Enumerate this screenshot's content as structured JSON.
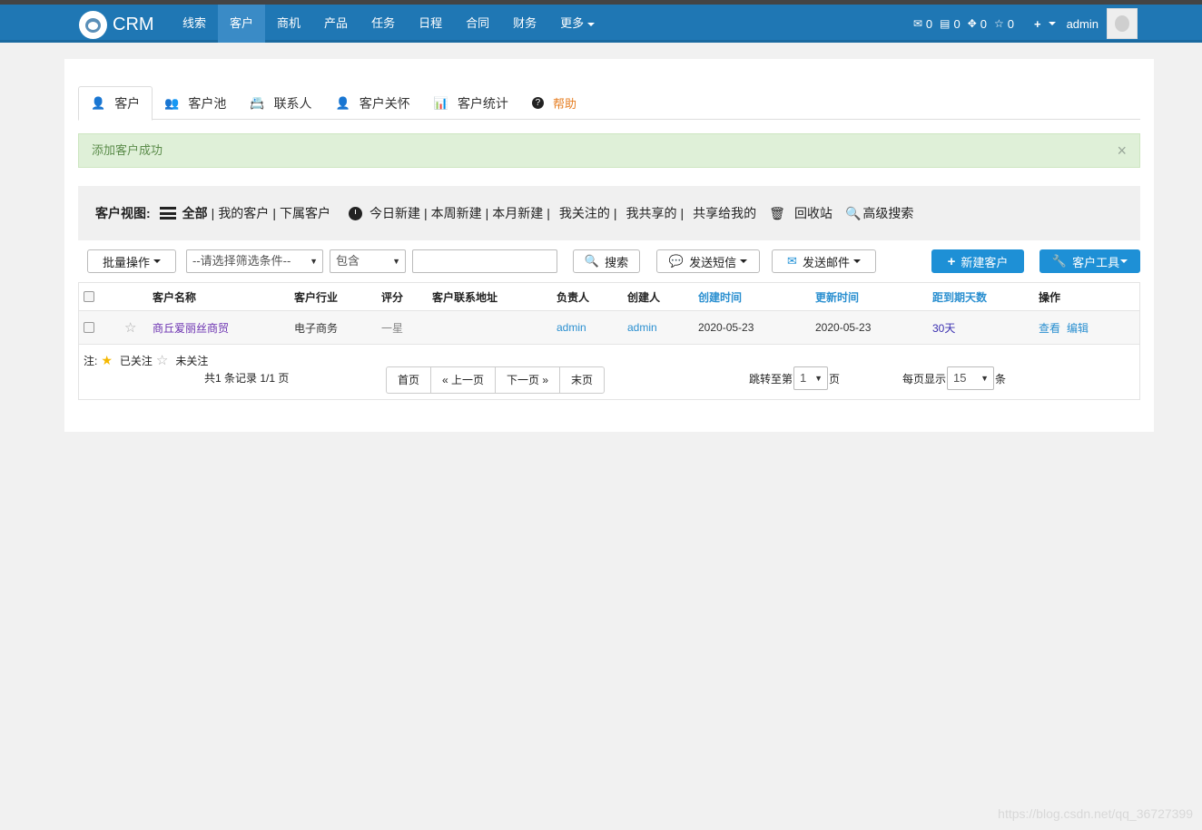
{
  "app": {
    "brand": "CRM"
  },
  "nav": {
    "items": [
      "线索",
      "客户",
      "商机",
      "产品",
      "任务",
      "日程",
      "合同",
      "财务",
      "更多"
    ],
    "active_index": 1,
    "stats": [
      {
        "icon": "mail-icon",
        "value": "0"
      },
      {
        "icon": "message-icon",
        "value": "0"
      },
      {
        "icon": "move-icon",
        "value": "0"
      },
      {
        "icon": "star-icon",
        "value": "0"
      }
    ],
    "plus_label": "+",
    "user": "admin"
  },
  "tabs": [
    {
      "label": "客户",
      "icon": "user-icon",
      "active": true
    },
    {
      "label": "客户池",
      "icon": "users-icon",
      "active": false
    },
    {
      "label": "联系人",
      "icon": "contacts-book-icon",
      "active": false
    },
    {
      "label": "客户关怀",
      "icon": "user-care-icon",
      "active": false
    },
    {
      "label": "客户统计",
      "icon": "chart-icon",
      "active": false
    },
    {
      "label": "帮助",
      "icon": "question-icon",
      "active": false
    }
  ],
  "alert": {
    "text": "添加客户成功",
    "close": "×"
  },
  "views": {
    "label": "客户视图:",
    "all": "全部",
    "mine": "我的客户",
    "sub": "下属客户",
    "today": "今日新建",
    "week": "本周新建",
    "month": "本月新建",
    "follow": "我关注的",
    "shared": "我共享的",
    "shared_to_me": "共享给我的",
    "recycle": "回收站",
    "advanced": "高级搜索"
  },
  "toolbar": {
    "batch": "批量操作",
    "filter_placeholder": "--请选择筛选条件--",
    "contains": "包含",
    "search": "搜索",
    "sms": "发送短信",
    "email": "发送邮件",
    "new_customer": "新建客户",
    "tools": "客户工具"
  },
  "table": {
    "headers": {
      "name": "客户名称",
      "industry": "客户行业",
      "rating": "评分",
      "address": "客户联系地址",
      "owner": "负责人",
      "creator": "创建人",
      "created": "创建时间",
      "updated": "更新时间",
      "days": "距到期天数",
      "ops": "操作"
    },
    "rows": [
      {
        "name": "商丘爱丽丝商贸",
        "industry": "电子商务",
        "rating": "一星",
        "address": "",
        "owner": "admin",
        "creator": "admin",
        "created": "2020-05-23",
        "updated": "2020-05-23",
        "days": "30天",
        "view": "查看",
        "edit": "编辑"
      }
    ]
  },
  "footer": {
    "note_prefix": "注:",
    "followed": "已关注",
    "unfollowed": "未关注",
    "total": "共1 条记录 1/1 页",
    "first": "首页",
    "prev": "« 上一页",
    "next": "下一页 »",
    "last": "末页",
    "jump_to": "跳转至第",
    "jump_value": "1",
    "page_unit": "页",
    "per_page": "每页显示",
    "per_page_value": "15",
    "per_page_unit": "条"
  },
  "watermark": "https://blog.csdn.net/qq_36727399",
  "colors": {
    "navbar": "#1f77b4",
    "primary": "#1e90d6",
    "alert_bg": "#dff0d8",
    "link": "#2a8fd0",
    "help": "#e67e22"
  }
}
